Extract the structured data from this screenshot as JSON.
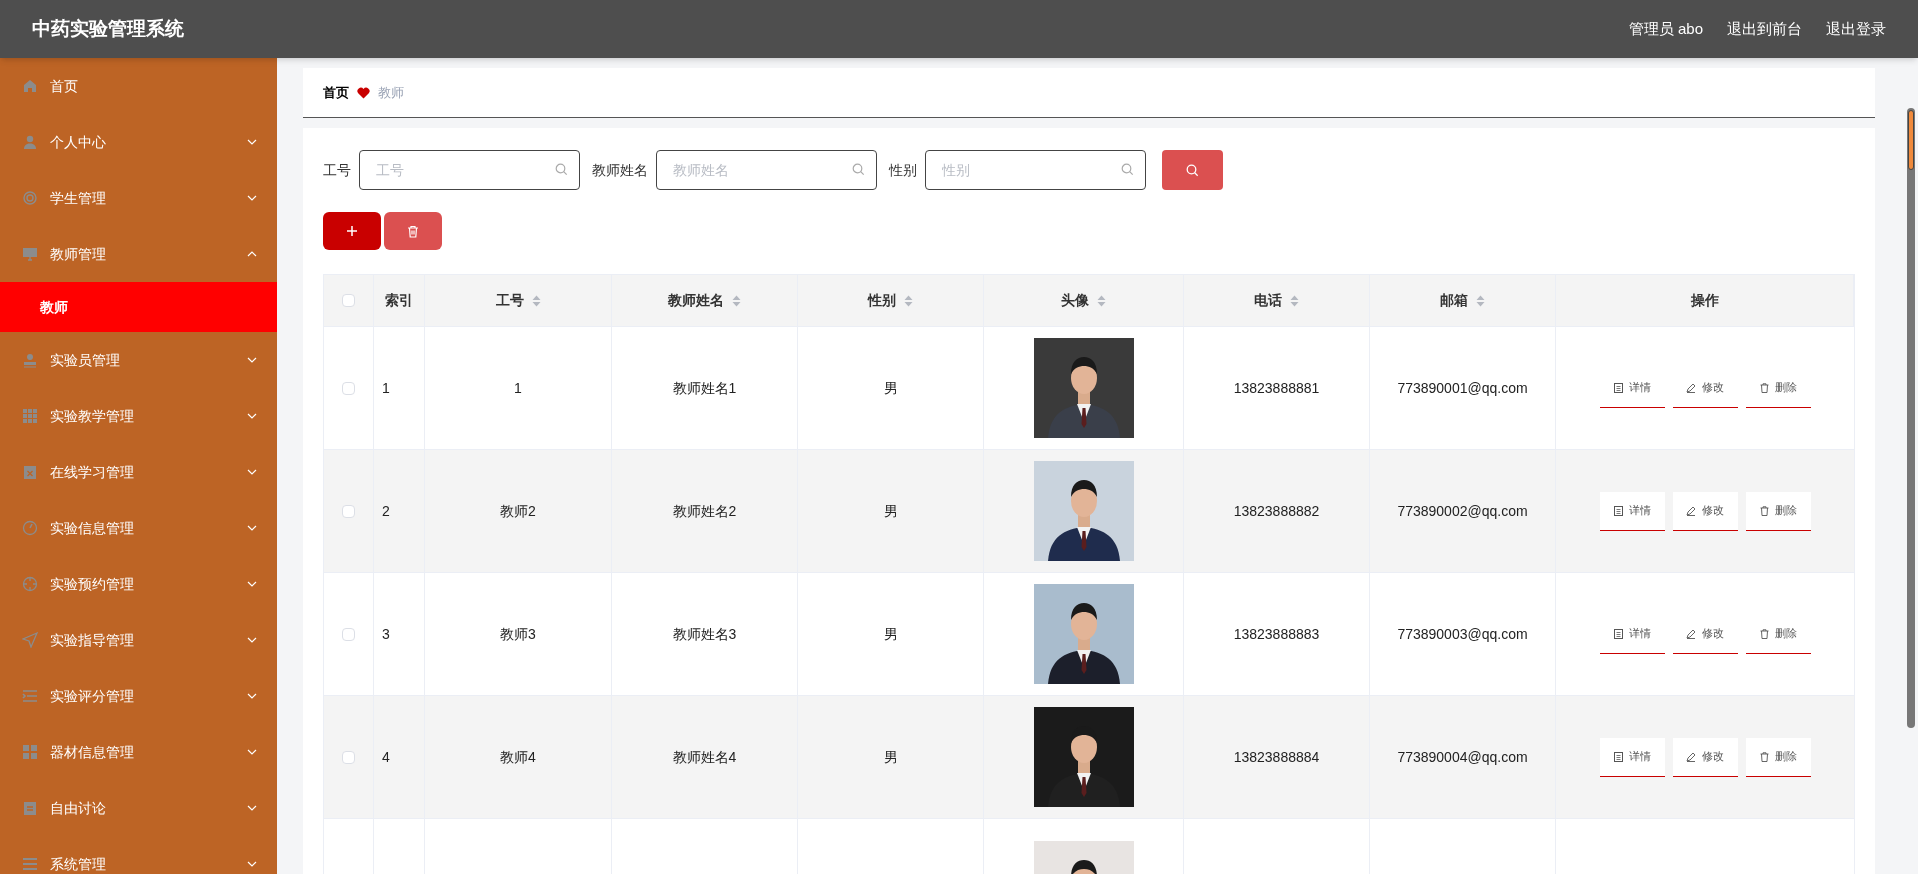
{
  "header": {
    "title": "中药实验管理系统",
    "links": [
      "管理员 abo",
      "退出到前台",
      "退出登录"
    ]
  },
  "sidebar": {
    "items": [
      {
        "label": "首页",
        "kind": "link"
      },
      {
        "label": "个人中心",
        "kind": "menu",
        "expanded": false
      },
      {
        "label": "学生管理",
        "kind": "menu",
        "expanded": false
      },
      {
        "label": "教师管理",
        "kind": "menu",
        "expanded": true,
        "children": [
          {
            "label": "教师",
            "selected": true
          }
        ]
      },
      {
        "label": "实验员管理",
        "kind": "menu",
        "expanded": false
      },
      {
        "label": "实验教学管理",
        "kind": "menu",
        "expanded": false
      },
      {
        "label": "在线学习管理",
        "kind": "menu",
        "expanded": false
      },
      {
        "label": "实验信息管理",
        "kind": "menu",
        "expanded": false
      },
      {
        "label": "实验预约管理",
        "kind": "menu",
        "expanded": false
      },
      {
        "label": "实验指导管理",
        "kind": "menu",
        "expanded": false
      },
      {
        "label": "实验评分管理",
        "kind": "menu",
        "expanded": false
      },
      {
        "label": "器材信息管理",
        "kind": "menu",
        "expanded": false
      },
      {
        "label": "自由讨论",
        "kind": "menu",
        "expanded": false
      },
      {
        "label": "系统管理",
        "kind": "menu",
        "expanded": false
      }
    ]
  },
  "breadcrumb": [
    "首页",
    "教师"
  ],
  "filters": [
    {
      "label": "工号",
      "placeholder": "工号"
    },
    {
      "label": "教师姓名",
      "placeholder": "教师姓名"
    },
    {
      "label": "性别",
      "placeholder": "性别"
    }
  ],
  "table": {
    "columns": [
      {
        "label": "索引",
        "kind": "plain"
      },
      {
        "label": "工号",
        "kind": "sortable"
      },
      {
        "label": "教师姓名",
        "kind": "sortable"
      },
      {
        "label": "性别",
        "kind": "sortable"
      },
      {
        "label": "头像",
        "kind": "sortable"
      },
      {
        "label": "电话",
        "kind": "sortable"
      },
      {
        "label": "邮箱",
        "kind": "sortable"
      },
      {
        "label": "操作",
        "kind": "plain"
      }
    ],
    "select_all": {
      "checked": false
    },
    "rows": [
      {
        "index": "1",
        "id": "1",
        "name": "教师姓名1",
        "gender": "男",
        "phone": "13823888881",
        "email": "773890001@qq.com",
        "checked": false,
        "actions": [
          "详情",
          "修改",
          "删除"
        ]
      },
      {
        "index": "2",
        "id": "教师2",
        "name": "教师姓名2",
        "gender": "男",
        "phone": "13823888882",
        "email": "773890002@qq.com",
        "checked": false,
        "actions": [
          "详情",
          "修改",
          "删除"
        ]
      },
      {
        "index": "3",
        "id": "教师3",
        "name": "教师姓名3",
        "gender": "男",
        "phone": "13823888883",
        "email": "773890003@qq.com",
        "checked": false,
        "actions": [
          "详情",
          "修改",
          "删除"
        ]
      },
      {
        "index": "4",
        "id": "教师4",
        "name": "教师姓名4",
        "gender": "男",
        "phone": "13823888884",
        "email": "773890004@qq.com",
        "checked": false,
        "actions": [
          "详情",
          "修改",
          "删除"
        ]
      },
      {
        "kind": "partial"
      }
    ]
  }
}
